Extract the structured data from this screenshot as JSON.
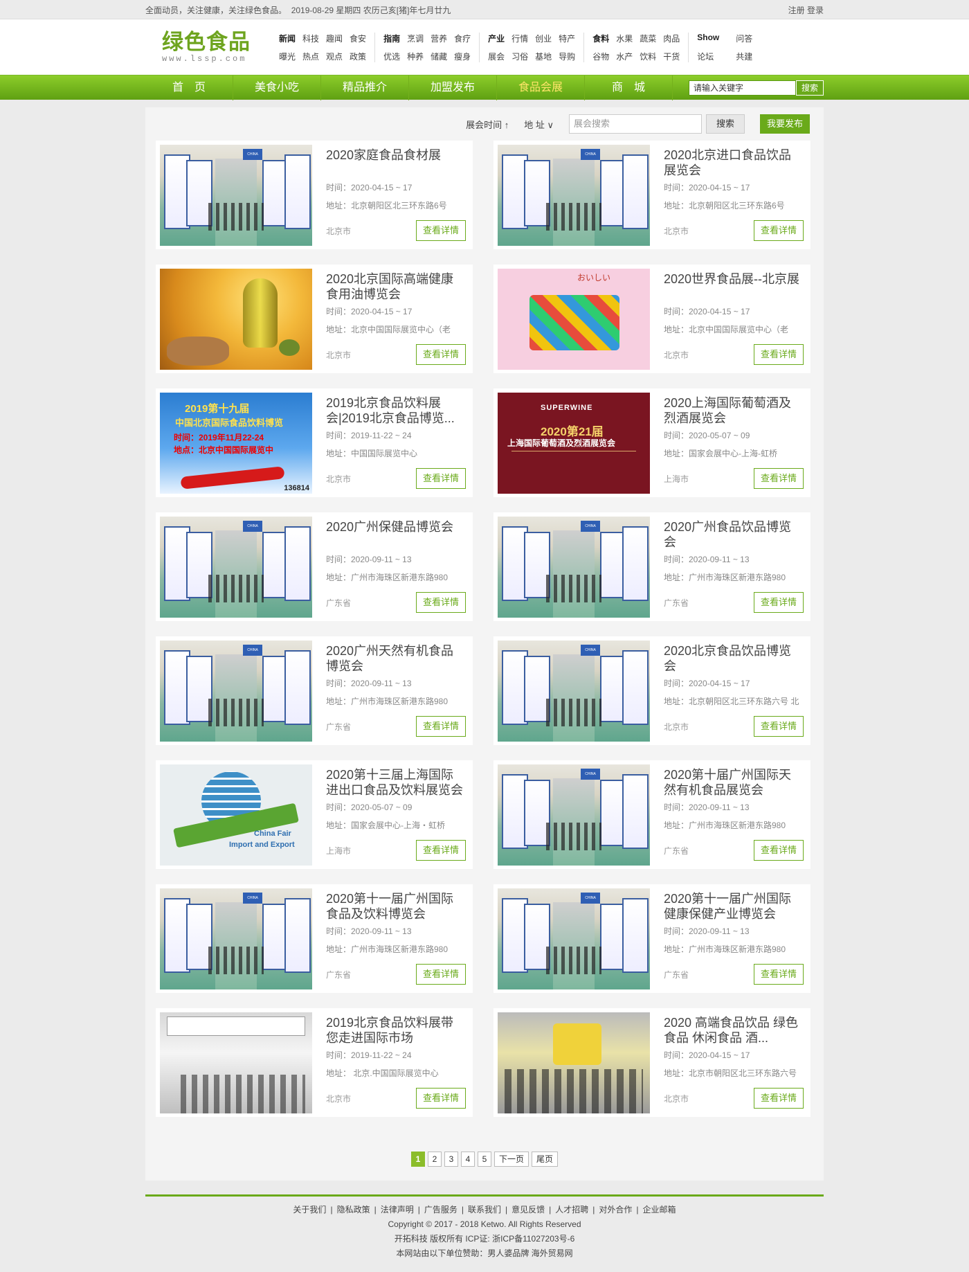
{
  "topbar": {
    "left_text": "全面动员，关注健康，关注绿色食品。",
    "date_text": "2019-08-29 星期四 农历己亥[猪]年七月廿九",
    "auth_text": "注册 登录"
  },
  "logo": {
    "main": "绿色食品",
    "sub": "www.lssp.com"
  },
  "header_nav": [
    {
      "row1": [
        "新闻",
        "科技",
        "趣闻",
        "食安"
      ],
      "row2": [
        "曝光",
        "热点",
        "观点",
        "政策"
      ],
      "strong": "新闻"
    },
    {
      "row1": [
        "指南",
        "烹调",
        "营养",
        "食疗"
      ],
      "row2": [
        "优选",
        "种养",
        "储藏",
        "瘦身"
      ],
      "strong": "指南"
    },
    {
      "row1": [
        "产业",
        "行情",
        "创业",
        "特产"
      ],
      "row2": [
        "展会",
        "习俗",
        "基地",
        "导购"
      ],
      "strong": "产业"
    },
    {
      "row1": [
        "食料",
        "水果",
        "蔬菜",
        "肉品"
      ],
      "row2": [
        "谷物",
        "水产",
        "饮料",
        "干货"
      ],
      "strong": "食料"
    },
    {
      "row1": [
        "Show",
        "问答"
      ],
      "row2": [
        "论坛",
        "共建"
      ],
      "strong": "Show"
    }
  ],
  "main_nav": {
    "items": [
      "首　页",
      "美食小吃",
      "精品推介",
      "加盟发布",
      "食品会展",
      "商　城"
    ],
    "active_index": 4,
    "search_placeholder": "请输入关键字",
    "search_button": "搜索"
  },
  "filter": {
    "time_label": "展会时间 ↑",
    "address_label": "地 址 ∨",
    "search_placeholder": "展会搜索",
    "search_button": "搜索",
    "publish_button": "我要发布"
  },
  "cards": [
    {
      "title": "2020家庭食品食材展",
      "time": "时间：2020-04-15 ~ 17",
      "address": "地址：北京朝阳区北三环东路6号",
      "city": "北京市",
      "button": "查看详情",
      "thumb": "expo"
    },
    {
      "title": "2020北京进口食品饮品展览会",
      "time": "时间：2020-04-15 ~ 17",
      "address": "地址：北京朝阳区北三环东路6号",
      "city": "北京市",
      "button": "查看详情",
      "thumb": "expo"
    },
    {
      "title": "2020北京国际高端健康食用油博览会",
      "time": "时间：2020-04-15 ~ 17",
      "address": "地址：北京中国国际展览中心（老",
      "city": "北京市",
      "button": "查看详情",
      "thumb": "oil"
    },
    {
      "title": "2020世界食品展--北京展",
      "time": "时间：2020-04-15 ~ 17",
      "address": "地址：北京中国国际展览中心（老",
      "city": "北京市",
      "button": "查看详情",
      "thumb": "pink"
    },
    {
      "title": "2019北京食品饮料展会|2019北京食品博览...",
      "time": "时间：2019-11-22 ~ 24",
      "address": "地址：中国国际展览中心",
      "city": "北京市",
      "button": "查看详情",
      "thumb": "2019"
    },
    {
      "title": "2020上海国际葡萄酒及烈酒展览会",
      "time": "时间：2020-05-07 ~ 09",
      "address": "地址：国家会展中心-上海-虹桥",
      "city": "上海市",
      "button": "查看详情",
      "thumb": "wine"
    },
    {
      "title": "2020广州保健品博览会",
      "time": "时间：2020-09-11 ~ 13",
      "address": "地址：广州市海珠区新港东路980",
      "city": "广东省",
      "button": "查看详情",
      "thumb": "expo"
    },
    {
      "title": "2020广州食品饮品博览会",
      "time": "时间：2020-09-11 ~ 13",
      "address": "地址：广州市海珠区新港东路980",
      "city": "广东省",
      "button": "查看详情",
      "thumb": "expo"
    },
    {
      "title": "2020广州天然有机食品博览会",
      "time": "时间：2020-09-11 ~ 13",
      "address": "地址：广州市海珠区新港东路980",
      "city": "广东省",
      "button": "查看详情",
      "thumb": "expo"
    },
    {
      "title": "2020北京食品饮品博览会",
      "time": "时间：2020-04-15 ~ 17",
      "address": "地址：北京朝阳区北三环东路六号 北",
      "city": "北京市",
      "button": "查看详情",
      "thumb": "expo"
    },
    {
      "title": "2020第十三届上海国际进出口食品及饮料展览会",
      "time": "时间：2020-05-07 ~ 09",
      "address": "地址：国家会展中心-上海・虹桥",
      "city": "上海市",
      "button": "查看详情",
      "thumb": "globe"
    },
    {
      "title": "2020第十届广州国际天然有机食品展览会",
      "time": "时间：2020-09-11 ~ 13",
      "address": "地址：广州市海珠区新港东路980",
      "city": "广东省",
      "button": "查看详情",
      "thumb": "expo"
    },
    {
      "title": "2020第十一届广州国际食品及饮料博览会",
      "time": "时间：2020-09-11 ~ 13",
      "address": "地址：广州市海珠区新港东路980",
      "city": "广东省",
      "button": "查看详情",
      "thumb": "expo"
    },
    {
      "title": "2020第十一届广州国际健康保健产业博览会",
      "time": "时间：2020-09-11 ~ 13",
      "address": "地址：广州市海珠区新港东路980",
      "city": "广东省",
      "button": "查看详情",
      "thumb": "expo"
    },
    {
      "title": "2019北京食品饮料展带您走进国际市场",
      "time": "时间：2019-11-22 ~ 24",
      "address": "地址： 北京.中国国际展览中心",
      "city": "北京市",
      "button": "查看详情",
      "thumb": "booth"
    },
    {
      "title": "2020 高端食品饮品 绿色食品 休闲食品 酒...",
      "time": "时间：2020-04-15 ~ 17",
      "address": "地址：北京市朝阳区北三环东路六号",
      "city": "北京市",
      "button": "查看详情",
      "thumb": "booth2"
    }
  ],
  "thumb_text": {
    "expo_sign": "CHINA",
    "pink_word": "おいしい",
    "y2019_l1": "2019第十九届",
    "y2019_l2": "中国北京国际食品饮料博览",
    "y2019_l3": "时间：2019年11月22-24",
    "y2019_l4": "地点：北京中国国际展览中",
    "y2019_num": "136814",
    "wine_brand": "SUPERWINE",
    "wine_big": "2020第21届",
    "wine_line": "上海国际葡萄酒及烈酒展览会",
    "globe_t1": "China Fair",
    "globe_t2": "Import and Export"
  },
  "pagination": {
    "pages": [
      "1",
      "2",
      "3",
      "4",
      "5"
    ],
    "current": "1",
    "next": "下一页",
    "last": "尾页"
  },
  "footer": {
    "links": [
      "关于我们",
      "隐私政策",
      "法律声明",
      "广告服务",
      "联系我们",
      "意见反馈",
      "人才招聘",
      "对外合作",
      "企业邮箱"
    ],
    "copyright": "Copyright © 2017 - 2018 Ketwo. All Rights Reserved",
    "icp": "开拓科技 版权所有 ICP证: 浙ICP备11027203号-6",
    "sponsor": "本网站由以下单位赞助：男人婆品牌 海外贸易网"
  },
  "colors": {
    "accent": "#6aaa1a",
    "nav_active": "#ffe56a"
  }
}
